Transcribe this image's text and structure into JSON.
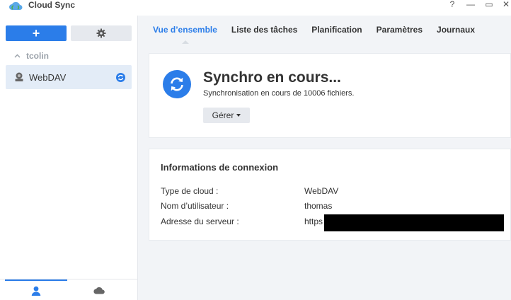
{
  "window": {
    "title": "Cloud Sync",
    "controls": [
      "?",
      "—",
      "▭",
      "✕"
    ]
  },
  "sidebar": {
    "add_button": "+",
    "group": {
      "label": "tcolin"
    },
    "items": [
      {
        "label": "WebDAV"
      }
    ]
  },
  "tabs": [
    {
      "label": "Vue d’ensemble"
    },
    {
      "label": "Liste des tâches"
    },
    {
      "label": "Planification"
    },
    {
      "label": "Paramètres"
    },
    {
      "label": "Journaux"
    }
  ],
  "status": {
    "title": "Synchro en cours...",
    "subtitle": "Synchronisation en cours de 10006 fichiers.",
    "manage_button": "Gérer"
  },
  "connection": {
    "title": "Informations de connexion",
    "rows": [
      {
        "label": "Type de cloud :",
        "value": "WebDAV"
      },
      {
        "label": "Nom d’utilisateur :",
        "value": "thomas"
      },
      {
        "label": "Adresse du serveur :",
        "value": "https"
      }
    ]
  },
  "colors": {
    "accent": "#2b7de9",
    "selected_bg": "#e3ecf7"
  }
}
